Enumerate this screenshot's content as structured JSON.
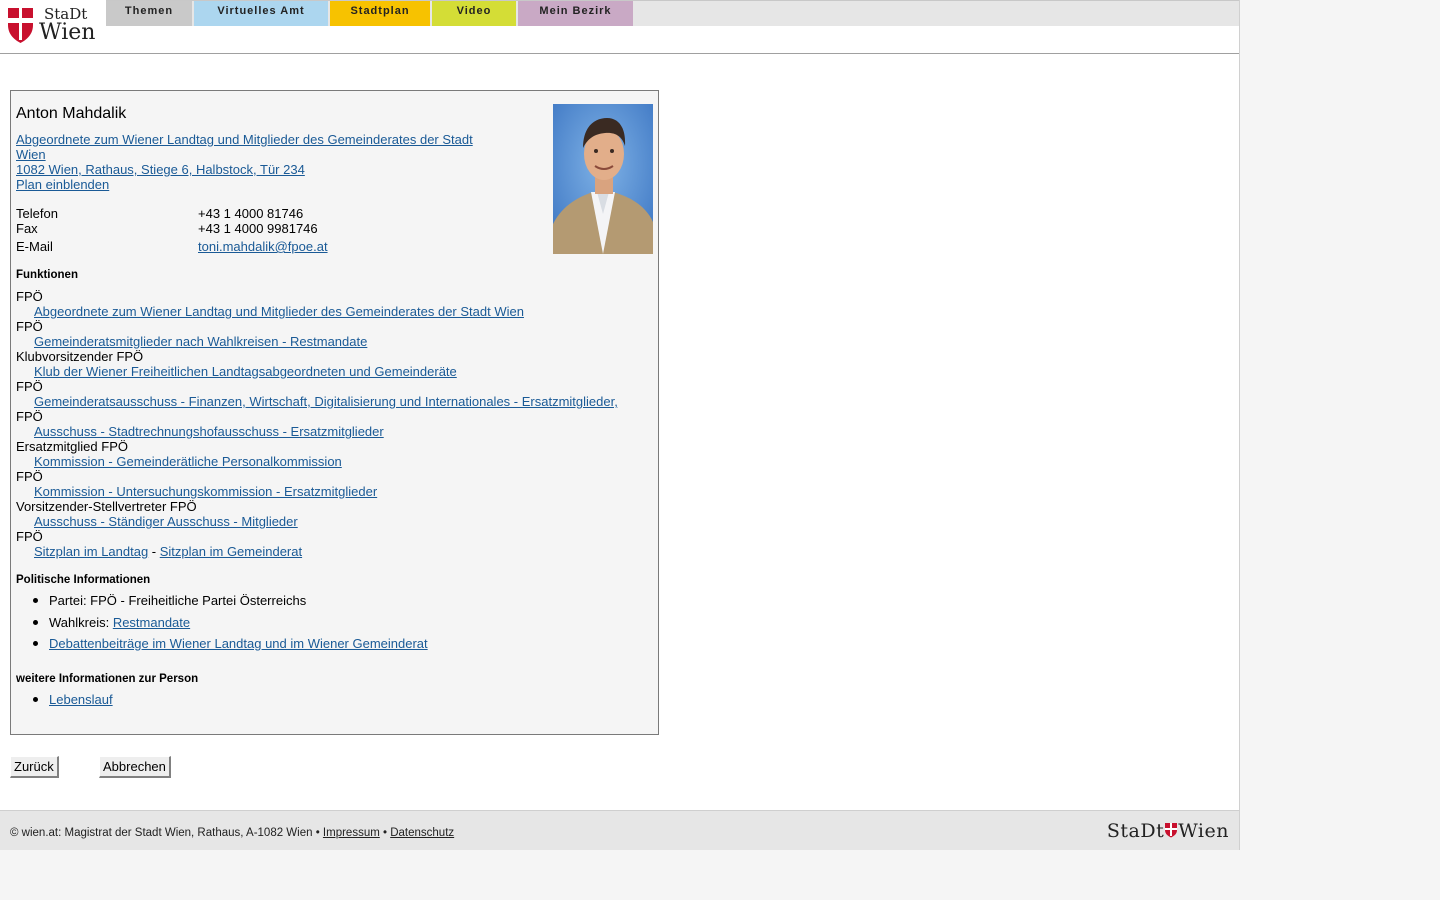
{
  "brand": {
    "stadt": "StaDt",
    "wien": "Wien"
  },
  "colors": {
    "flag_red": "#c8102e",
    "link": "#1a5a96"
  },
  "nav": {
    "tabs": [
      {
        "label": "Themen",
        "color": "#c9c9c9"
      },
      {
        "label": "Virtuelles Amt",
        "color": "#acd6ef"
      },
      {
        "label": "Stadtplan",
        "color": "#f7c200"
      },
      {
        "label": "Video",
        "color": "#d4dd36"
      },
      {
        "label": "Mein Bezirk",
        "color": "#c9a9c5"
      }
    ]
  },
  "person": {
    "name": "Anton Mahdalik",
    "title_line1": "Abgeordnete zum Wiener Landtag und Mitglieder des Gemeinderates der Stadt",
    "title_line2": "Wien",
    "address": "1082 Wien, Rathaus, Stiege 6, Halbstock, Tür 234",
    "plan_link": "Plan einblenden",
    "contact": {
      "telefon_label": "Telefon",
      "telefon": "+43 1 4000 81746",
      "fax_label": "Fax",
      "fax": "+43 1 4000 9981746",
      "email_label": "E-Mail",
      "email": "toni.mahdalik@fpoe.at"
    }
  },
  "functions": {
    "heading": "Funktionen",
    "items": [
      {
        "role": "FPÖ",
        "link": "Abgeordnete zum Wiener Landtag und Mitglieder des Gemeinderates der Stadt Wien"
      },
      {
        "role": "FPÖ",
        "link": "Gemeinderatsmitglieder nach Wahlkreisen - Restmandate"
      },
      {
        "role": "Klubvorsitzender FPÖ",
        "link": "Klub der Wiener Freiheitlichen Landtagsabgeordneten und Gemeinderäte"
      },
      {
        "role": "FPÖ",
        "link": "Gemeinderatsausschuss - Finanzen, Wirtschaft, Digitalisierung und Internationales - Ersatzmitglieder, "
      },
      {
        "role": "FPÖ",
        "link": "Ausschuss - Stadtrechnungshofausschuss - Ersatzmitglieder"
      },
      {
        "role": "Ersatzmitglied FPÖ",
        "link": "Kommission - Gemeinderätliche Personalkommission"
      },
      {
        "role": "FPÖ",
        "link": "Kommission - Untersuchungskommission - Ersatzmitglieder"
      },
      {
        "role": "Vorsitzender-Stellvertreter FPÖ",
        "link": "Ausschuss - Ständiger Ausschuss - Mitglieder"
      }
    ],
    "last_role": "FPÖ",
    "sitzplan_landtag": "Sitzplan im Landtag",
    "separator": " - ",
    "sitzplan_gemeinderat": "Sitzplan im Gemeinderat"
  },
  "political": {
    "heading": "Politische Informationen",
    "partei": "Partei: FPÖ - Freiheitliche Partei Österreichs",
    "wahlkreis_label": "Wahlkreis: ",
    "wahlkreis": "Restmandate",
    "debatten": "Debattenbeiträge im Wiener Landtag und im Wiener Gemeinderat"
  },
  "more": {
    "heading": "weitere Informationen zur Person",
    "lebenslauf": "Lebenslauf"
  },
  "buttons": {
    "back": "Zurück",
    "cancel": "Abbrechen"
  },
  "footer": {
    "copyright": "© wien.at: Magistrat der Stadt Wien, Rathaus, A-1082 Wien • ",
    "impressum": "Impressum",
    "bullet": " • ",
    "datenschutz": "Datenschutz",
    "logo_stadt": "StaDt",
    "logo_wien": "Wien"
  }
}
